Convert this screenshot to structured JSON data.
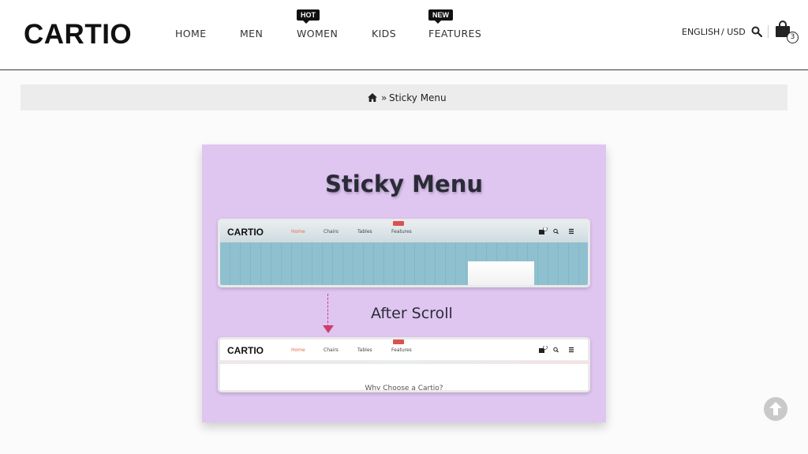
{
  "header": {
    "logo": "CARTIO",
    "nav": [
      {
        "label": "HOME"
      },
      {
        "label": "MEN"
      },
      {
        "label": "WOMEN",
        "badge": "HOT"
      },
      {
        "label": "KIDS"
      },
      {
        "label": "FEATURES",
        "badge": "NEW"
      }
    ],
    "language": "ENGLISH",
    "currency": "/ USD",
    "cart_count": "3",
    "icons": {
      "search": "search-icon",
      "cart": "shopping-bag-icon"
    }
  },
  "breadcrumb": {
    "home_icon": "home-icon",
    "separator": "»",
    "current": "Sticky Menu"
  },
  "feature": {
    "title": "Sticky Menu",
    "after_label": "After Scroll",
    "preview": {
      "logo": "CARTIO",
      "links": [
        "Home",
        "Chairs",
        "Tables",
        "Features"
      ],
      "active_link": "Home",
      "badge": "NEW",
      "cart_count": "0",
      "caption": "Why Choose a Cartio?"
    }
  },
  "colors": {
    "card_background": "#dec6f1",
    "accent_arrow": "#d23c6b",
    "active_link": "#e96a4a"
  },
  "scroll_to_top_icon": "arrow-up-circle-icon"
}
